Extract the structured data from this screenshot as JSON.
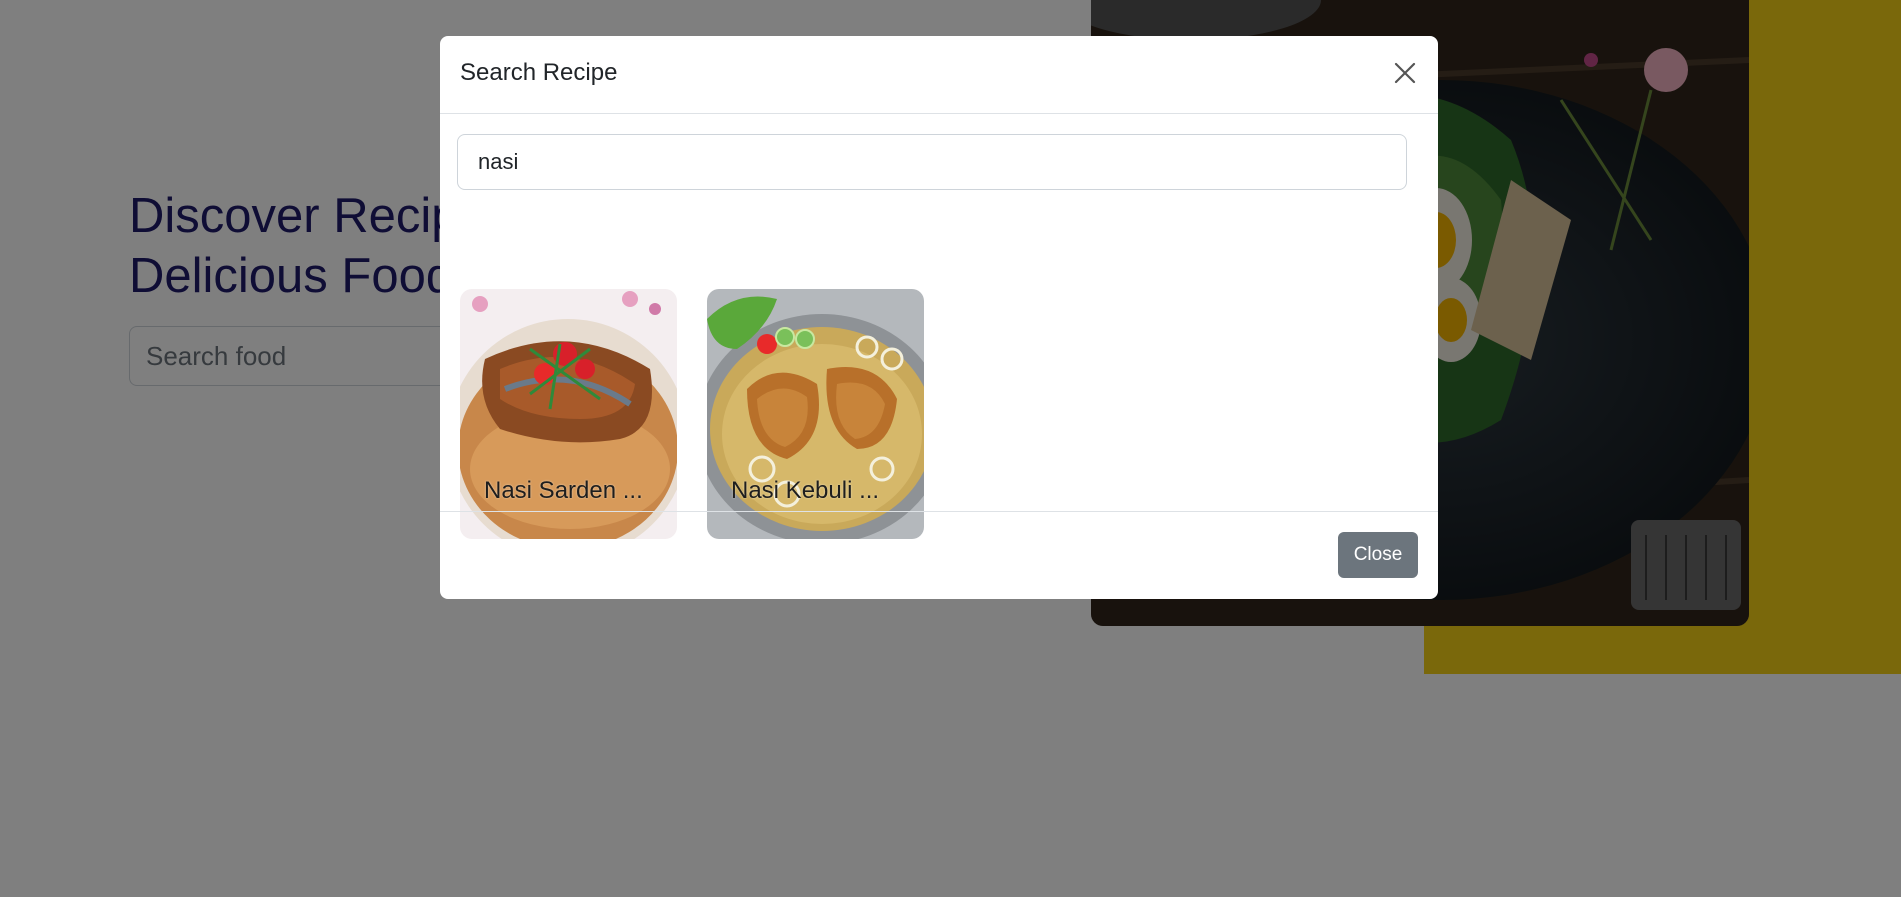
{
  "hero": {
    "title_line1": "Discover Recipes",
    "title_line2": "Delicious Food",
    "search_placeholder": "Search food"
  },
  "modal": {
    "title": "Search Recipe",
    "search_value": "nasi",
    "results": [
      {
        "label": "Nasi Sarden ..."
      },
      {
        "label": "Nasi Kebuli ..."
      }
    ],
    "close_label": "Close"
  },
  "colors": {
    "accent_yellow": "#f5d016",
    "title_navy": "#1f1a6b",
    "close_button": "#6c757d"
  },
  "icons": {
    "close": "close-icon"
  }
}
